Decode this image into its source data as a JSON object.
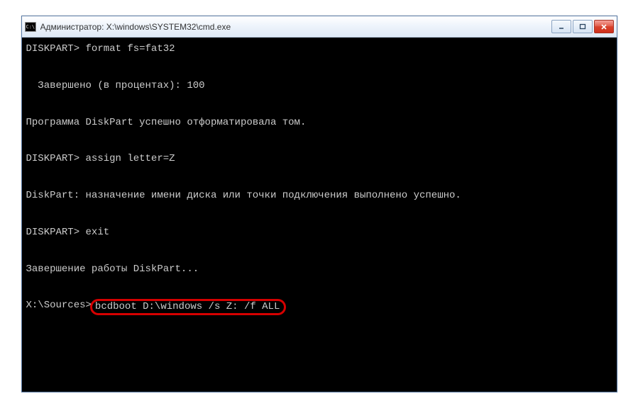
{
  "window": {
    "title": "Администратор: X:\\windows\\SYSTEM32\\cmd.exe"
  },
  "console": {
    "lines": [
      {
        "prompt": "DISKPART> ",
        "text": "format fs=fat32"
      },
      {
        "prompt": "",
        "text": ""
      },
      {
        "prompt": "",
        "text": "  Завершено (в процентах): 100"
      },
      {
        "prompt": "",
        "text": ""
      },
      {
        "prompt": "",
        "text": "Программа DiskPart успешно отформатировала том."
      },
      {
        "prompt": "",
        "text": ""
      },
      {
        "prompt": "DISKPART> ",
        "text": "assign letter=Z"
      },
      {
        "prompt": "",
        "text": ""
      },
      {
        "prompt": "",
        "text": "DiskPart: назначение имени диска или точки подключения выполнено успешно."
      },
      {
        "prompt": "",
        "text": ""
      },
      {
        "prompt": "DISKPART> ",
        "text": "exit"
      },
      {
        "prompt": "",
        "text": ""
      },
      {
        "prompt": "",
        "text": "Завершение работы DiskPart..."
      },
      {
        "prompt": "",
        "text": ""
      }
    ],
    "highlightedLine": {
      "prompt": "X:\\Sources>",
      "command": "bcdboot D:\\windows /s Z: /f ALL"
    }
  },
  "colors": {
    "highlight": "#d60000"
  }
}
